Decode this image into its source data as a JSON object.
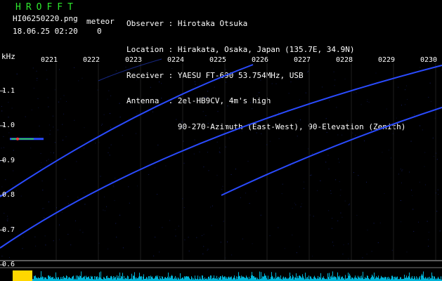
{
  "header": {
    "title": "HROFFT",
    "filename": "HI06250220.png",
    "meteor_label": "meteor",
    "datetime": "18.06.25 02:20",
    "meteor_count": "0"
  },
  "station_info": [
    {
      "key": "Observer",
      "sep": ":",
      "value": "Hirotaka Otsuka"
    },
    {
      "key": "Location",
      "sep": ":",
      "value": "Hirakata, Osaka, Japan (135.7E, 34.9N)"
    },
    {
      "key": "Receiver",
      "sep": ":",
      "value": "YAESU FT-690 53.754MHz, USB"
    },
    {
      "key": "Antenna",
      "sep": ":",
      "value": "2el-HB9CV, 4m's high"
    },
    {
      "key": "",
      "sep": "",
      "value": "90-270-Azimuth (East-West), 90-Elevation (Zenith)"
    }
  ],
  "spectrogram": {
    "y_unit": "kHz",
    "y_ticks": [
      "1.1",
      "1.0",
      "0.9",
      "0.8",
      "0.7",
      "0.6"
    ],
    "time_ticks": [
      "0221",
      "0222",
      "0223",
      "0224",
      "0225",
      "0226",
      "0227",
      "0228",
      "0229",
      "0230"
    ],
    "colors": {
      "background": "#000000",
      "trace": "#2a4bff",
      "signal": "#2ee82e",
      "noise_histogram": "#00b4d8",
      "activity_bar": "#ffd700",
      "tick": "#b8b8b8"
    }
  }
}
